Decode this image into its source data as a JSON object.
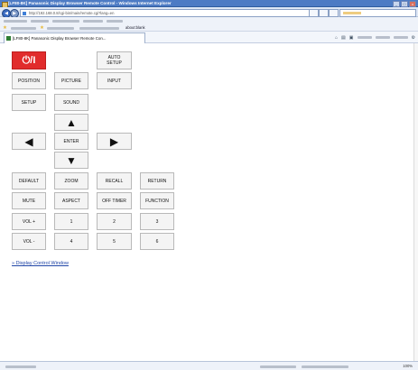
{
  "window": {
    "title": "[LF80-8K] Panasonic Display Browser Remote Control - Windows Internet Explorer",
    "min_glyph": "_",
    "max_glyph": "□",
    "close_glyph": "x"
  },
  "address_bar": {
    "url": "http://192.168.0.8/cgi-bin/main/remote.cgi?lang=en",
    "back_glyph": "◀",
    "forward_glyph": "▶"
  },
  "favorites_bar": {
    "about_label": "about:blank"
  },
  "tab": {
    "label": "[LF80-8K] Panasonic Display Browser Remote Con..."
  },
  "toolbar_icons": {
    "home": "⌂",
    "feeds": "▤",
    "print": "▣",
    "settings": "⚙"
  },
  "remote": {
    "power_label": "⏻/I",
    "auto_setup_line1": "AUTO",
    "auto_setup_line2": "SETUP",
    "position": "POSITION",
    "picture": "PICTURE",
    "input": "INPUT",
    "setup": "SETUP",
    "sound": "SOUND",
    "up_arrow": "▲",
    "left_arrow": "◀",
    "enter": "ENTER",
    "right_arrow": "▶",
    "down_arrow": "▼",
    "default": "DEFAULT",
    "zoom": "ZOOM",
    "recall": "RECALL",
    "return": "RETURN",
    "mute": "MUTE",
    "aspect": "ASPECT",
    "off_timer": "OFF TIMER",
    "function": "FUNCTION",
    "vol_up": "VOL +",
    "key_1": "1",
    "key_2": "2",
    "key_3": "3",
    "vol_down": "VOL -",
    "key_4": "4",
    "key_5": "5",
    "key_6": "6"
  },
  "link": {
    "label": "» Display Control Window"
  },
  "status_bar": {
    "zoom": "100%"
  },
  "colors": {
    "power_button": "#e12c2c",
    "title_bar": "#4d7bc4",
    "link": "#2247a8"
  }
}
